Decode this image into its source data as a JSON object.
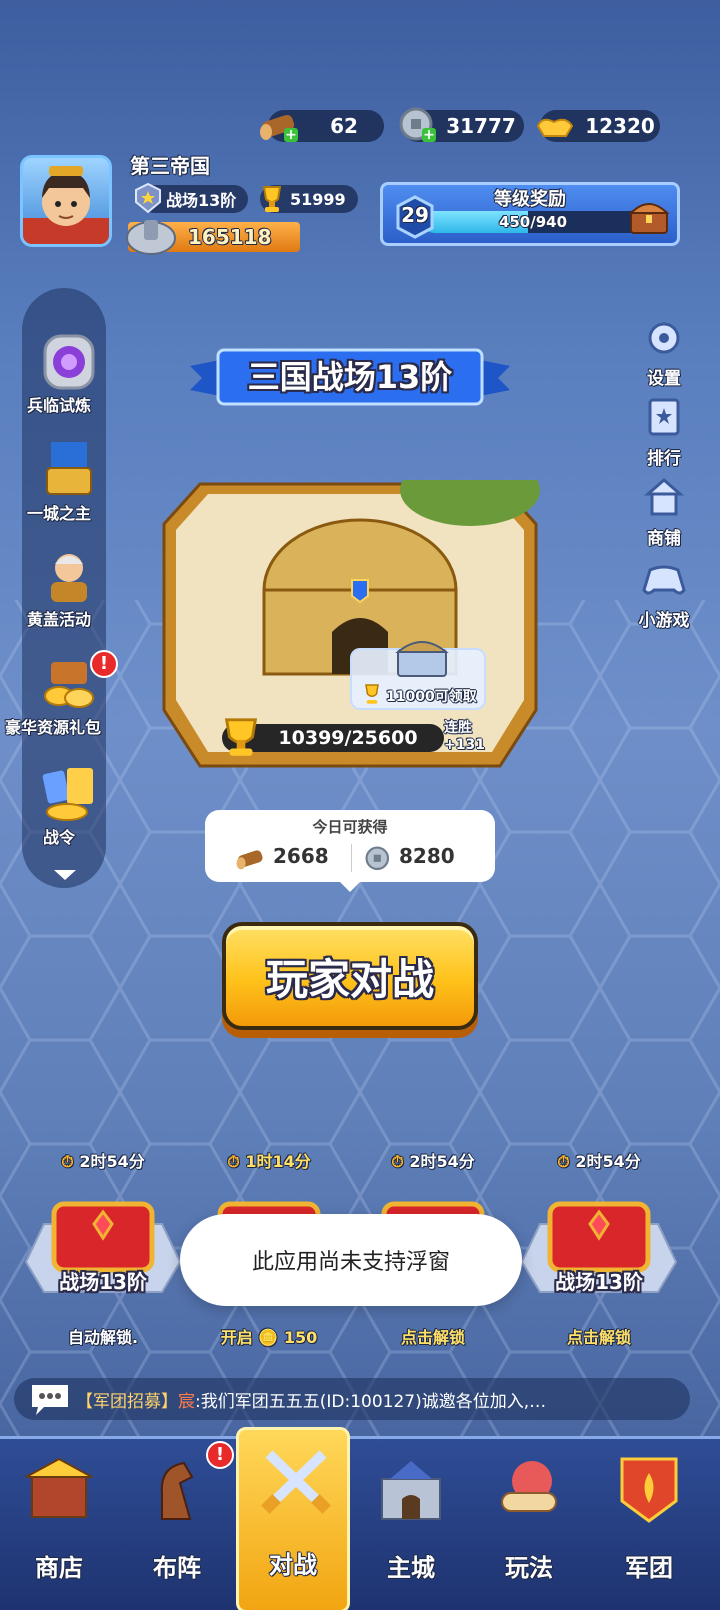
{
  "resources": {
    "wood": "62",
    "coins": "31777",
    "gold": "12320"
  },
  "player": {
    "name": "第三帝国",
    "rank": "战场13阶",
    "trophies": "51999",
    "power": "165118"
  },
  "level_reward": {
    "title": "等级奖励",
    "level": "29",
    "progress": "450/940",
    "fraction": 0.479
  },
  "sidebar": [
    {
      "label": "兵临试炼",
      "icon": "portal-icon"
    },
    {
      "label": "一城之主",
      "icon": "throne-icon"
    },
    {
      "label": "黄盖活动",
      "icon": "warrior-icon"
    },
    {
      "label": "豪华资源礼包",
      "icon": "gold-pack-icon"
    },
    {
      "label": "战令",
      "icon": "battle-pass-icon"
    }
  ],
  "right_menu": [
    {
      "label": "设置",
      "icon": "gear-icon"
    },
    {
      "label": "排行",
      "icon": "ranking-icon"
    },
    {
      "label": "商铺",
      "icon": "shop-icon"
    },
    {
      "label": "小游戏",
      "icon": "gamepad-icon"
    }
  ],
  "arena": {
    "title": "三国战场13阶",
    "trophy_progress": "10399/25600",
    "streak_label": "连胜",
    "streak_value": "+131",
    "claim_text": "11000可领取"
  },
  "today": {
    "title": "今日可获得",
    "wood": "2668",
    "coins": "8280"
  },
  "battle_button": "玩家对战",
  "chest_slots": [
    {
      "timer": "2时54分",
      "name": "战场13阶",
      "action": "自动解锁."
    },
    {
      "timer": "1时14分",
      "name": "",
      "action": "开启",
      "cost": "150"
    },
    {
      "timer": "2时54分",
      "name": "",
      "action": "点击解锁"
    },
    {
      "timer": "2时54分",
      "name": "战场13阶",
      "action": "点击解锁"
    }
  ],
  "toast": "此应用尚未支持浮窗",
  "chat": {
    "channel": "【军团招募】",
    "sender": "宸",
    "message": ":我们军团五五五(ID:100127)诚邀各位加入,…"
  },
  "bottom_nav": [
    {
      "label": "商店",
      "icon": "shop-stall-icon"
    },
    {
      "label": "布阵",
      "icon": "horse-piece-icon"
    },
    {
      "label": "对战",
      "icon": "crossed-swords-icon"
    },
    {
      "label": "主城",
      "icon": "city-gate-icon"
    },
    {
      "label": "玩法",
      "icon": "scroll-icon"
    },
    {
      "label": "军团",
      "icon": "legion-flag-icon"
    }
  ],
  "badges": {
    "gold_pack": "!",
    "formation": "!"
  }
}
